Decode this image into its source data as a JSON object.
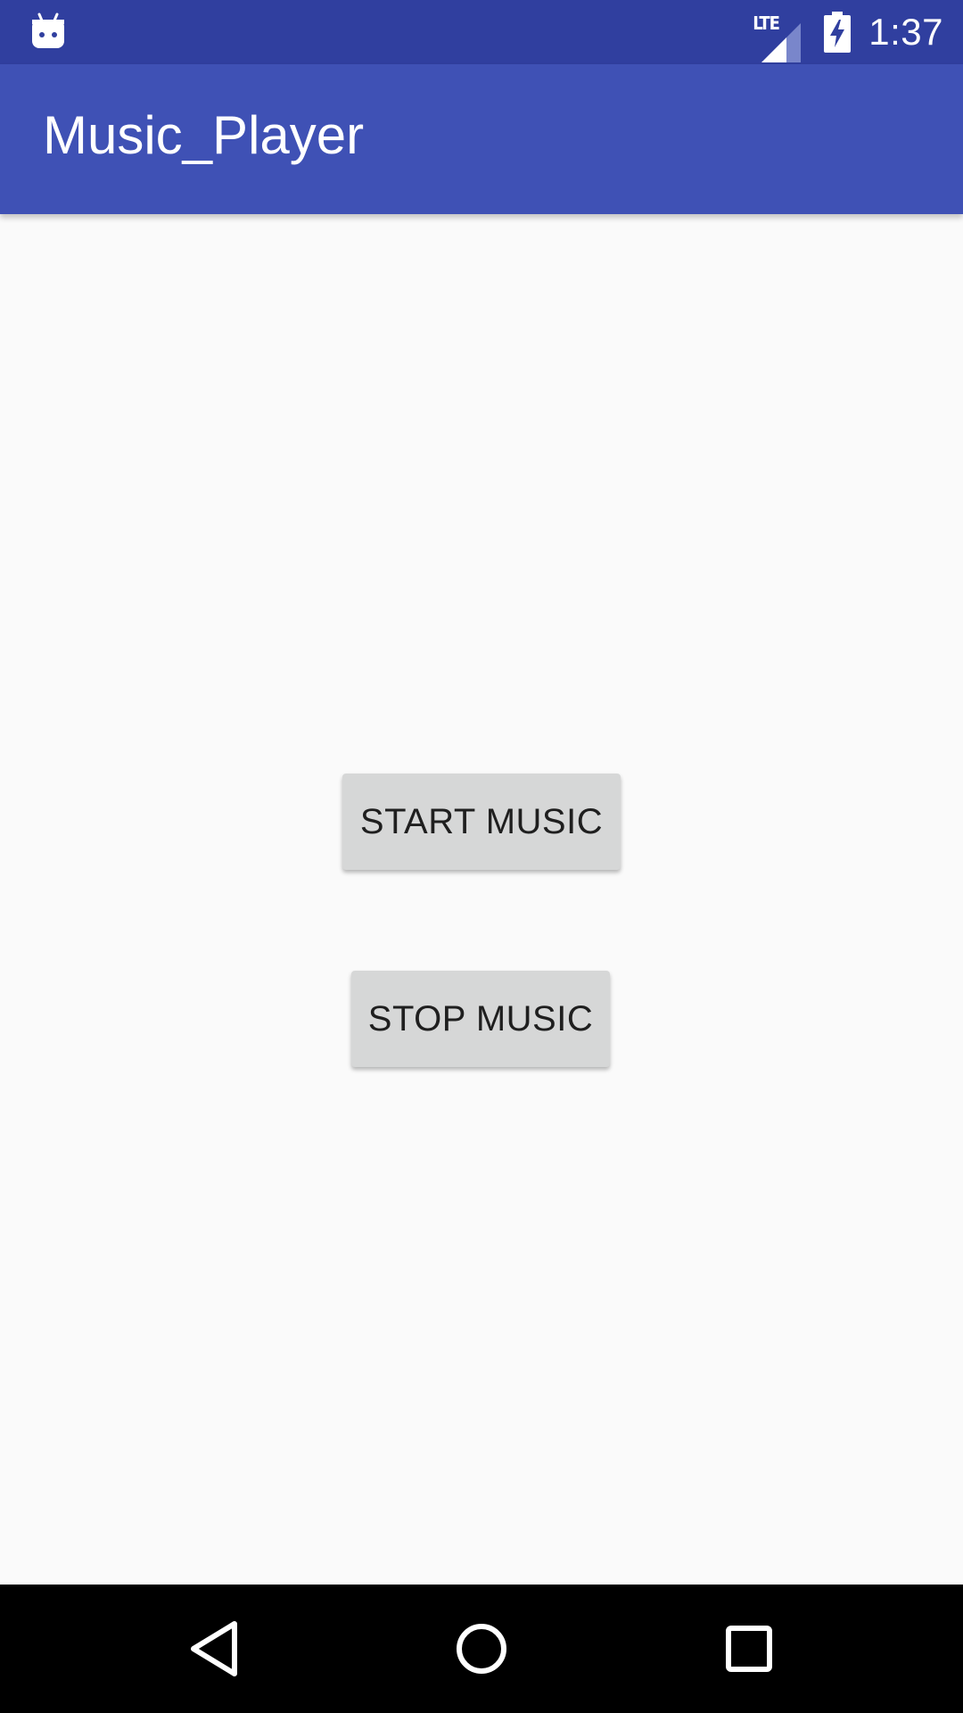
{
  "status_bar": {
    "notification_icon": "android-debug-icon",
    "network_label": "LTE",
    "signal_icon": "cell-signal-icon",
    "battery_icon": "battery-charging-icon",
    "time": "1:37",
    "background_color": "#303f9f"
  },
  "app_bar": {
    "title": "Music_Player",
    "background_color": "#3f51b5"
  },
  "main": {
    "start_button_label": "START MUSIC",
    "stop_button_label": "STOP MUSIC",
    "button_color": "#d6d7d7"
  },
  "nav_bar": {
    "back_icon": "back-triangle-icon",
    "home_icon": "home-circle-icon",
    "recents_icon": "recents-square-icon"
  }
}
